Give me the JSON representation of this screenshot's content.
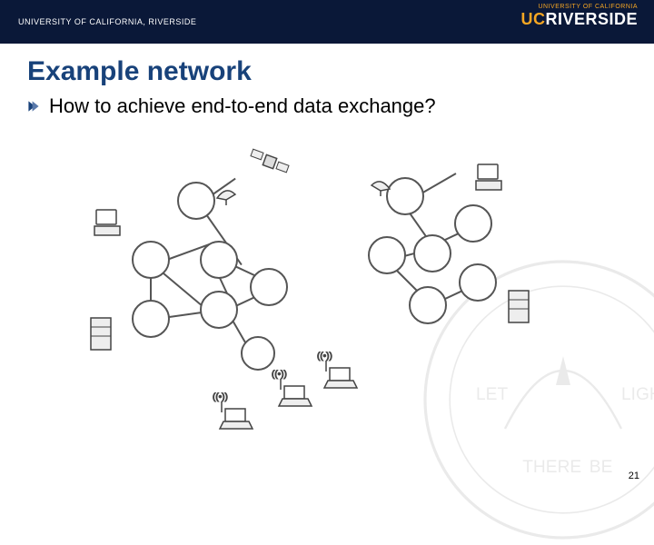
{
  "header": {
    "left_text": "UNIVERSITY OF CALIFORNIA, RIVERSIDE",
    "right_small": "UNIVERSITY OF CALIFORNIA",
    "right_prefix": "UC",
    "right_main": "RIVERSIDE"
  },
  "title": "Example network",
  "bullet": "How to achieve end-to-end data exchange?",
  "page_number": "21",
  "seal_motto_left": "LET",
  "seal_motto_mid": "THERE",
  "seal_motto_mid2": "BE",
  "seal_motto_right": "LIGHT"
}
